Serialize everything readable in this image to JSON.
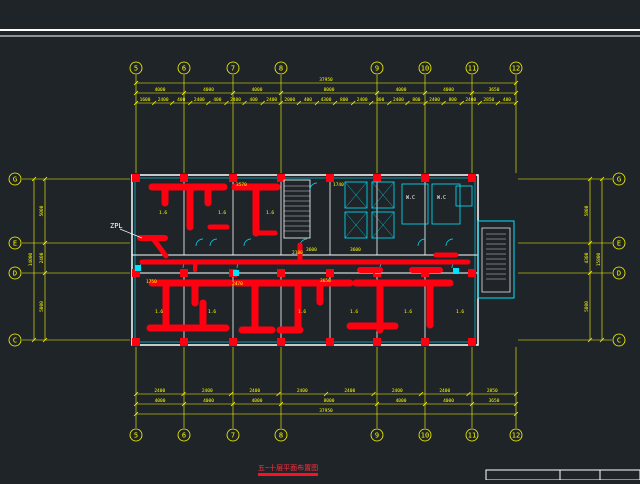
{
  "drawing": {
    "colors": {
      "background": "#1f2429",
      "frame": "#ffffff",
      "dimension": "#ffff00",
      "wall": "#ffffff",
      "fixture": "#00e5ff",
      "duct": "#ff0010",
      "stair": "#ffffff",
      "title": "#ff2030"
    },
    "title": "五~十层平面布置图",
    "zpl_label": "ZPL",
    "grid_columns_top": [
      "5",
      "6",
      "7",
      "8",
      "9",
      "10",
      "11",
      "12"
    ],
    "grid_columns_bottom": [
      "5",
      "6",
      "7",
      "8",
      "9",
      "10",
      "11",
      "12"
    ],
    "grid_rows_left": [
      "G",
      "E",
      "D",
      "C"
    ],
    "grid_rows_right": [
      "G",
      "E",
      "D",
      "C"
    ],
    "top_total_dim": "37950",
    "top_dims_row1": [
      "4000",
      "4000",
      "4000",
      "8000",
      "4000",
      "4000",
      "3650"
    ],
    "top_dims_row2": [
      "1600",
      "2400",
      "400",
      "2400",
      "400",
      "2400",
      "400",
      "2400",
      "2000",
      "400",
      "4300",
      "800",
      "2400",
      "800",
      "2400",
      "800",
      "2400",
      "800",
      "2400",
      "2850",
      "400"
    ],
    "bottom_dims_row1": [
      "2400",
      "2400",
      "2400",
      "2400",
      "2400",
      "2400",
      "2400",
      "2850"
    ],
    "bottom_dims_row2": [
      "4000",
      "4000",
      "4000",
      "8000",
      "4000",
      "4000",
      "3650"
    ],
    "bottom_total_dim": "37950",
    "left_dims": [
      "5000",
      "2400",
      "5000"
    ],
    "left_total_dim": "14000",
    "right_dims": [
      "5800",
      "4300",
      "5800"
    ],
    "right_total_dim": "15800",
    "room_labels": [
      "1.6",
      "1.6",
      "1.6",
      "1.6",
      "1.6",
      "1.6",
      "1.6",
      "1.6",
      "1.6"
    ],
    "interior_dims": [
      "3570",
      "1740",
      "2100",
      "2470",
      "3650",
      "1750",
      "3600",
      "3600"
    ],
    "toilet_labels": [
      "W.C",
      "W.C"
    ],
    "title_block": ""
  }
}
